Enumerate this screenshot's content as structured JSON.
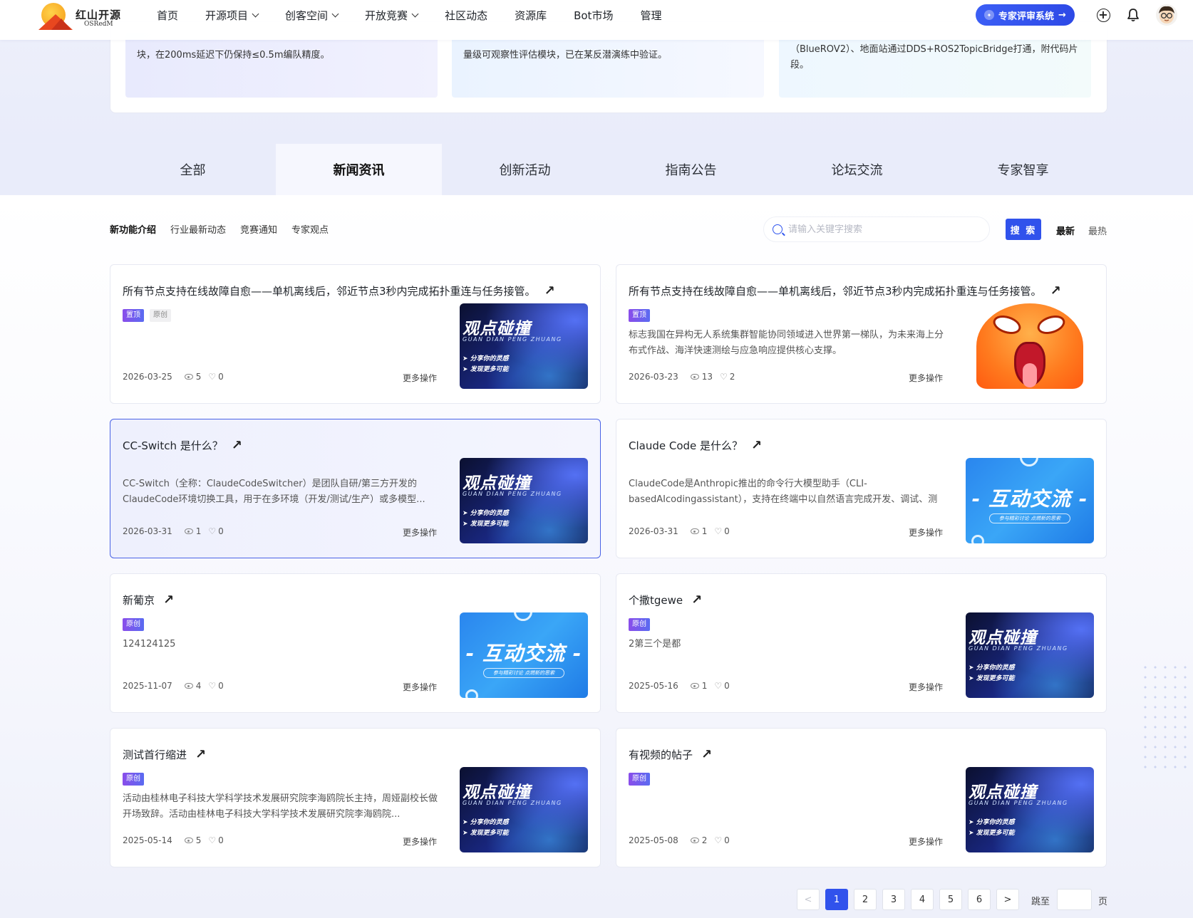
{
  "header": {
    "logo_cn": "红山开源",
    "logo_en": "OSRedM",
    "nav": [
      "首页",
      "开源项目",
      "创客空间",
      "开放竞赛",
      "社区动态",
      "资源库",
      "Bot市场",
      "管理"
    ],
    "nav_dropdown": [
      false,
      true,
      true,
      true,
      false,
      false,
      false,
      false
    ],
    "expert_button": "专家评审系统"
  },
  "top_cards": [
    "块，在200ms延迟下仍保持≤0.5m编队精度。",
    "量级可观察性评估模块，已在某反潜演练中验证。",
    "（BlueROV2）、地面站通过DDS+ROS2TopicBridge打通，附代码片段。"
  ],
  "tabs": {
    "items": [
      "全部",
      "新闻资讯",
      "创新活动",
      "指南公告",
      "论坛交流",
      "专家智享"
    ],
    "active_index": 1
  },
  "subtabs": {
    "items": [
      "新功能介绍",
      "行业最新动态",
      "竞赛通知",
      "专家观点"
    ],
    "active_index": 0
  },
  "search": {
    "placeholder": "请输入关键字搜索",
    "value": "",
    "button": "搜 索"
  },
  "sort": {
    "latest": "最新",
    "hottest": "最热",
    "active": "latest"
  },
  "thumb_text": {
    "dark_big": "观点碰撞",
    "dark_pinyin": "GUAN DIAN PENG ZHUANG",
    "dark_line1": "➤ 分享你的灵感",
    "dark_line2": "➤ 发现更多可能",
    "blue_big": "- 互动交流 -",
    "blue_sub": "参与精彩讨论 点燃新的思索"
  },
  "posts": [
    {
      "title": "所有节点支持在线故障自愈——单机离线后，邻近节点3秒内完成拓扑重连与任务接管。",
      "tags": [
        "置顶",
        "原创"
      ],
      "desc": "",
      "date": "2026-03-25",
      "views": "5",
      "likes": "0",
      "more": "更多操作",
      "thumb": "dark",
      "highlight": false
    },
    {
      "title": "所有节点支持在线故障自愈——单机离线后，邻近节点3秒内完成拓扑重连与任务接管。",
      "tags": [
        "置顶"
      ],
      "desc": "标志我国在异构无人系统集群智能协同领域进入世界第一梯队，为未来海上分布式作战、海洋快速测绘与应急响应提供核心支撑。",
      "date": "2026-03-23",
      "views": "13",
      "likes": "2",
      "more": "更多操作",
      "thumb": "emoji",
      "highlight": false
    },
    {
      "title": "CC-Switch 是什么？",
      "tags": [],
      "desc": "CC-Switch（全称：ClaudeCodeSwitcher）是团队自研/第三方开发的ClaudeCode环境切换工具，用于在多环境（开发/测试/生产）或多模型...",
      "date": "2026-03-31",
      "views": "1",
      "likes": "0",
      "more": "更多操作",
      "thumb": "dark",
      "highlight": true
    },
    {
      "title": "Claude Code 是什么？",
      "tags": [],
      "desc": "ClaudeCode是Anthropic推出的命令行大模型助手（CLI-basedAIcodingassistant），支持在终端中以自然语言完成开发、调试、测试全流程...",
      "date": "2026-03-31",
      "views": "1",
      "likes": "0",
      "more": "更多操作",
      "thumb": "blue",
      "highlight": false
    },
    {
      "title": "新葡京",
      "tags": [
        "原创"
      ],
      "desc": "124124125",
      "date": "2025-11-07",
      "views": "4",
      "likes": "0",
      "more": "更多操作",
      "thumb": "blue",
      "highlight": false
    },
    {
      "title": "个撒tgewe",
      "tags": [
        "原创"
      ],
      "desc": "2第三个是都",
      "date": "2025-05-16",
      "views": "1",
      "likes": "0",
      "more": "更多操作",
      "thumb": "dark",
      "highlight": false
    },
    {
      "title": "测试首行缩进",
      "tags": [
        "原创"
      ],
      "desc": "活动由桂林电子科技大学科学技术发展研究院李海鸥院长主持，周娅副校长做开场致辞。活动由桂林电子科技大学科学技术发展研究院李海鸥院...",
      "date": "2025-05-14",
      "views": "5",
      "likes": "0",
      "more": "更多操作",
      "thumb": "dark",
      "highlight": false
    },
    {
      "title": "有视频的帖子",
      "tags": [
        "原创"
      ],
      "desc": "",
      "date": "2025-05-08",
      "views": "2",
      "likes": "0",
      "more": "更多操作",
      "thumb": "dark",
      "highlight": false
    }
  ],
  "pagination": {
    "prev": "<",
    "pages": [
      "1",
      "2",
      "3",
      "4",
      "5",
      "6"
    ],
    "current": "1",
    "next": ">",
    "jump_prefix": "跳至",
    "jump_suffix": "页"
  },
  "colors": {
    "accent": "#3052ec",
    "tag_gradient_start": "#8a4dea",
    "tag_gradient_end": "#5a6bf1"
  }
}
